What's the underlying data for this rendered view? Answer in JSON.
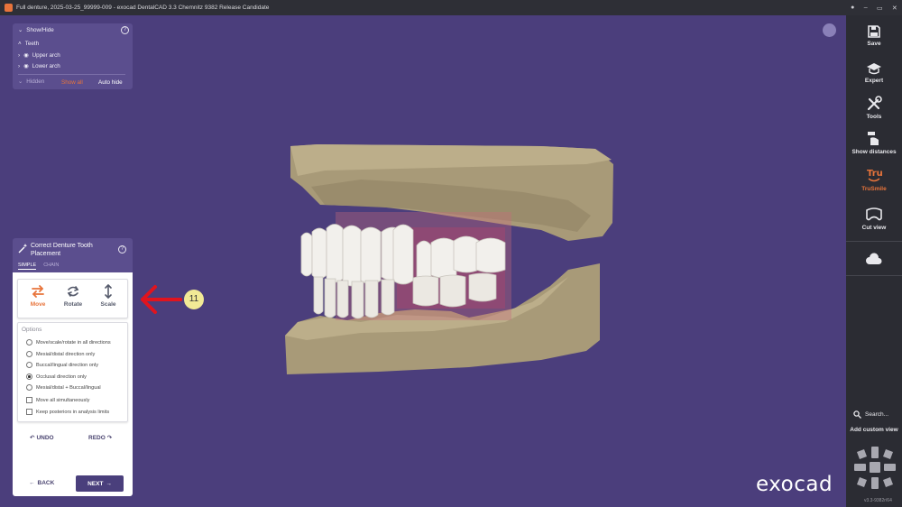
{
  "window": {
    "title": "Full denture, 2025-03-25_99999-009 - exocad DentalCAD 3.3 Chemnitz 9382 Release Candidate",
    "controls": [
      "–",
      "▭",
      "✕"
    ]
  },
  "toolbar": {
    "items": [
      {
        "label": "Save",
        "icon": "save-icon"
      },
      {
        "label": "Expert",
        "icon": "graduation-cap-icon"
      },
      {
        "label": "Tools",
        "icon": "tools-icon"
      },
      {
        "label": "Show distances",
        "icon": "distances-icon"
      },
      {
        "label": "TruSmile",
        "icon": "trusmile-icon"
      },
      {
        "label": "Cut view",
        "icon": "cut-view-icon"
      }
    ],
    "search_label": "Search...",
    "custom_view_label": "Add custom view",
    "version": "v3.3-9382r/64"
  },
  "showhide": {
    "title": "Show/Hide",
    "teeth": "Teeth",
    "upper": "Upper arch",
    "lower": "Lower arch",
    "hidden": "Hidden",
    "show_all": "Show all",
    "auto_hide": "Auto hide"
  },
  "placement": {
    "title": "Correct Denture Tooth Placement",
    "tabs": [
      "SIMPLE",
      "CHAIN"
    ],
    "modes": [
      {
        "label": "Move",
        "active": true
      },
      {
        "label": "Rotate",
        "active": false
      },
      {
        "label": "Scale",
        "active": false
      }
    ],
    "options_title": "Options",
    "options": [
      {
        "label": "Move/scale/rotate in all directions",
        "type": "radio",
        "checked": false
      },
      {
        "label": "Mesial/distal direction only",
        "type": "radio",
        "checked": false
      },
      {
        "label": "Buccal/lingual direction only",
        "type": "radio",
        "checked": false
      },
      {
        "label": "Occlusal direction only",
        "type": "radio",
        "checked": true
      },
      {
        "label": "Mesial/distal + Buccal/lingual",
        "type": "radio",
        "checked": false
      },
      {
        "label": "Move all simultaneously",
        "type": "checkbox",
        "checked": false
      },
      {
        "label": "Keep posteriors in analysis limits",
        "type": "checkbox",
        "checked": false
      }
    ],
    "undo": "UNDO",
    "redo": "REDO",
    "back": "BACK",
    "next": "NEXT"
  },
  "annotation": {
    "number": "11"
  },
  "brand": "exocad",
  "colors": {
    "accent": "#e8743b",
    "viewport": "#4b3e7c",
    "panel": "#5b4e8e",
    "annotation_arrow": "#e0141e"
  }
}
